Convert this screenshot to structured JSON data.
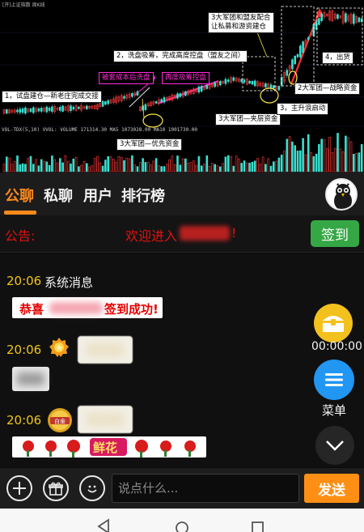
{
  "chart": {
    "top_label": "[开]上证指数 周K线",
    "vol_label": "VOL-TDX(5,10) VVOL: VOLUME 171314.30 MA5 1073028.00 MA10 1001730.00",
    "annotations": {
      "a1": "1，试盘建仓—新老庄完成交接",
      "a2": "2，洗盘吸筹，完成高度控盘（盟友之间）",
      "a3": "被套成本后洗盘",
      "a4": "再度吸筹控盘",
      "a5": "3大军团和盟友配合让私募和游资建仓",
      "a6": "3大军团—夹层资金",
      "a7": "3大军团—优先资金",
      "a8": "2大军团—战略资金",
      "a9": "3，主升浪启动",
      "a10": "4，出货"
    }
  },
  "tabs": {
    "items": [
      "公聊",
      "私聊",
      "用户",
      "排行榜"
    ],
    "active_index": 0
  },
  "notice": {
    "label": "公告:",
    "text": "欢迎进入",
    "bang": "!",
    "signin": "签到"
  },
  "chat": {
    "system": {
      "time": "20:06",
      "name": "系统消息",
      "msg_prefix": "恭喜",
      "msg_suffix": "签到成功!"
    },
    "msg2": {
      "time": "20:06"
    },
    "msg3": {
      "time": "20:06",
      "badge_text": "白金",
      "flower_text": "鲜花"
    }
  },
  "floating": {
    "timer": "00:00:00",
    "menu_label": "菜单"
  },
  "inputbar": {
    "placeholder": "说点什么...",
    "send": "发送"
  },
  "colors": {
    "accent": "#ff8a1a",
    "notice_red": "#e01212",
    "signin_green": "#35a845",
    "menu_blue": "#2196f3",
    "gold": "#f0c419"
  }
}
